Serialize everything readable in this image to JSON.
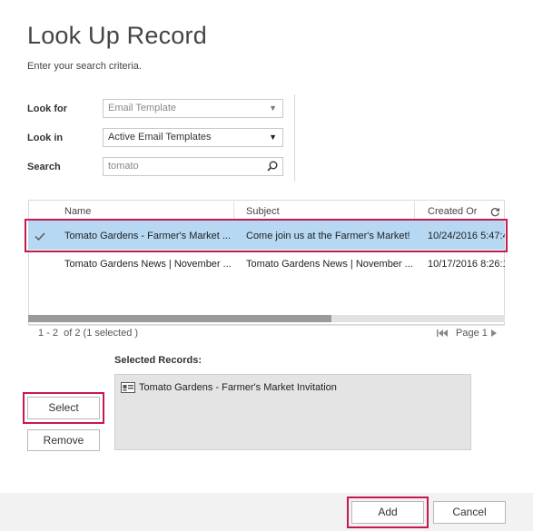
{
  "dialog": {
    "title": "Look Up Record",
    "subtitle": "Enter your search criteria."
  },
  "form": {
    "look_for_label": "Look for",
    "look_for_value": "Email Template",
    "look_in_label": "Look in",
    "look_in_value": "Active Email Templates",
    "search_label": "Search",
    "search_value": "tomato"
  },
  "grid": {
    "columns": [
      "Name",
      "Subject",
      "Created Or"
    ],
    "rows": [
      {
        "name": "Tomato Gardens - Farmer's Market ...",
        "subject": "Come join us at the Farmer's Market!",
        "created": "10/24/2016 5:47:4",
        "selected": true
      },
      {
        "name": "Tomato Gardens News | November ...",
        "subject": "Tomato Gardens News | November ...",
        "created": "10/17/2016 8:26:1",
        "selected": false
      }
    ],
    "status": "1 - 2  of 2 (1 selected )",
    "page_label": "Page 1"
  },
  "selected_records": {
    "label": "Selected Records:",
    "items": [
      "Tomato Gardens - Farmer's Market Invitation"
    ]
  },
  "buttons": {
    "select": "Select",
    "remove": "Remove",
    "add": "Add",
    "cancel": "Cancel"
  },
  "colors": {
    "highlight": "#c41a4e",
    "selected_row": "#b6d8f2"
  },
  "icons": [
    "chevron-down-icon",
    "search-icon",
    "refresh-icon",
    "checkmark-icon",
    "first-page-icon",
    "next-page-icon",
    "record-card-icon"
  ]
}
